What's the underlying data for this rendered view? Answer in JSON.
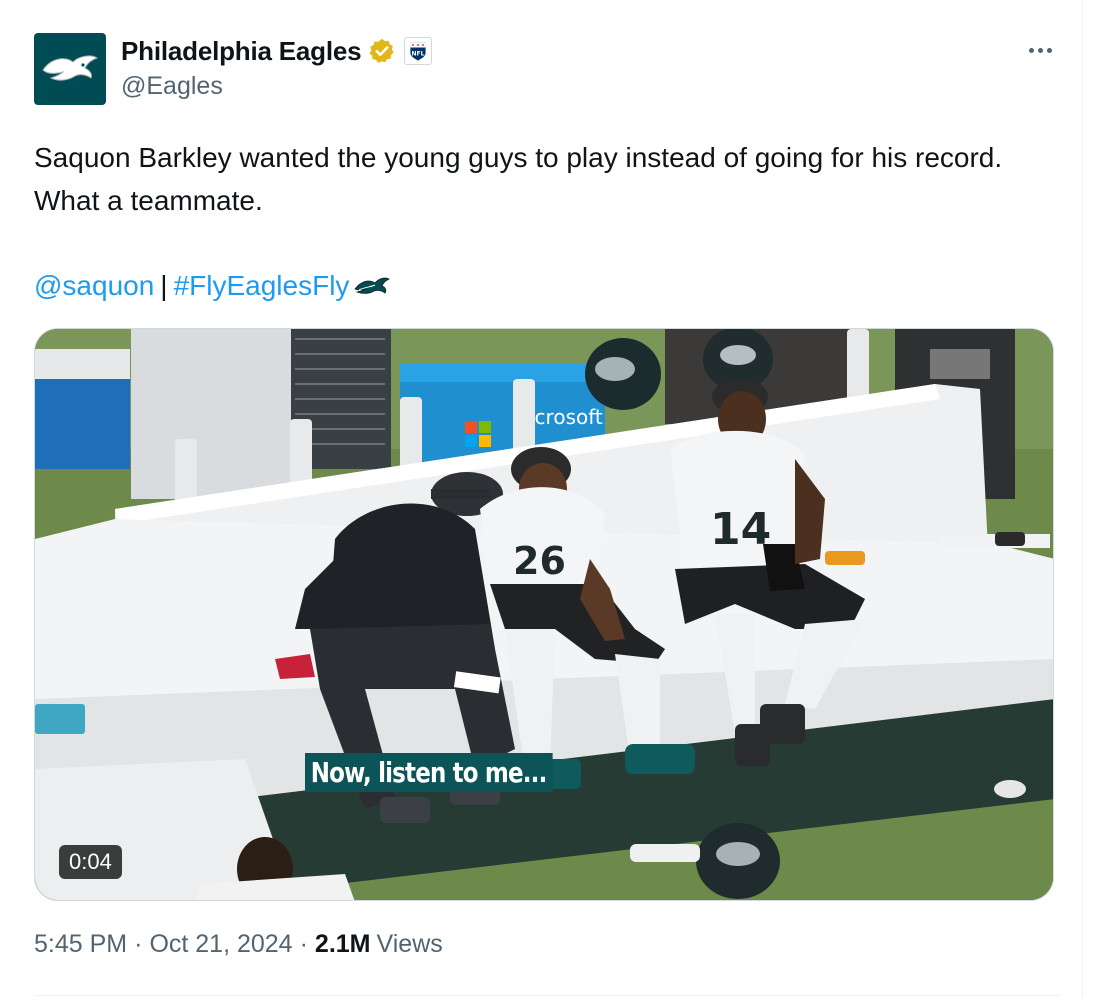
{
  "author": {
    "display_name": "Philadelphia Eagles",
    "handle": "@Eagles",
    "verified_badge": "gold-verified-icon",
    "affiliate_badge": "nfl-logo-icon",
    "avatar": "eagles-logo"
  },
  "menu": {
    "icon": "more-icon"
  },
  "tweet": {
    "text": "Saquon Barkley wanted the young guys to play instead of going for his record. What a teammate.",
    "mention": "@saquon",
    "separator": "|",
    "hashtag": "#FlyEaglesFly"
  },
  "media": {
    "caption": "Now, listen to me...",
    "duration": "0:04",
    "type": "video"
  },
  "meta": {
    "time": "5:45 PM",
    "dot": "·",
    "date": "Oct 21, 2024",
    "views_count": "2.1M",
    "views_label": "Views"
  },
  "colors": {
    "link": "#1d9bf0",
    "text": "#0f1419",
    "secondary": "#536471",
    "verified": "#e2b719",
    "eagles_green": "#004c54"
  }
}
